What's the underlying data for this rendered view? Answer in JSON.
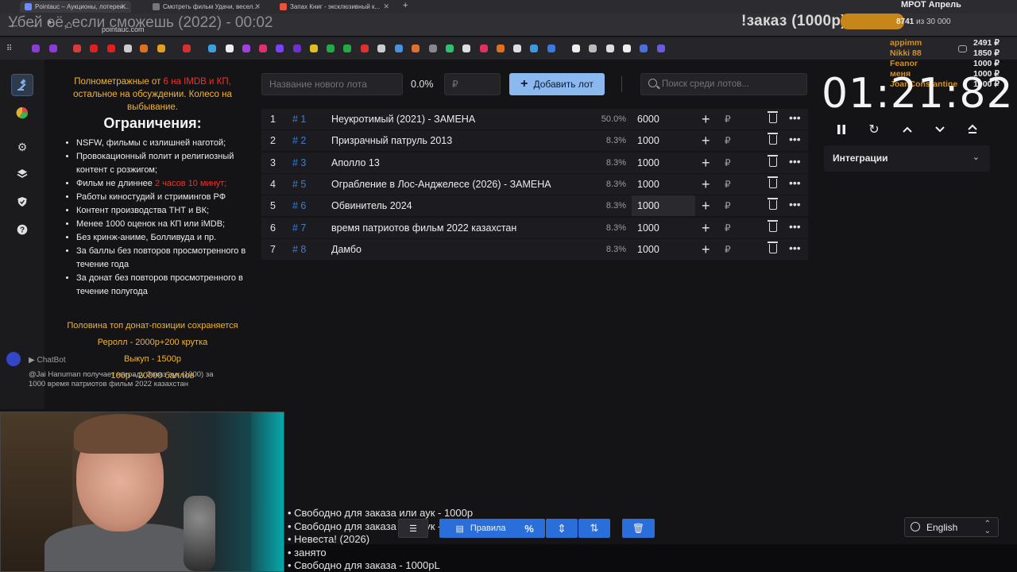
{
  "browser": {
    "tabs": [
      {
        "title": "Pointauc – Аукционы, лотереи...",
        "active": true
      },
      {
        "title": "Смотреть фильм Удачи, весел...",
        "active": false
      },
      {
        "title": "Запах Книг - эксклюзивный к...",
        "active": false
      }
    ],
    "url": "pointauc.com"
  },
  "overlay": {
    "stream_title": "Убей её, если сможешь (2022) - 00:02",
    "order_label": "!заказ (1000р)",
    "mrot_title": "МРОТ Апрель",
    "mrot_value": "8741",
    "mrot_of": "из 30 000",
    "donors": [
      {
        "name": "appimm",
        "amount": "2491 ₽"
      },
      {
        "name": "Nikki 88",
        "amount": "1850 ₽"
      },
      {
        "name": "Feanor",
        "amount": "1000 ₽"
      },
      {
        "name": "меня",
        "amount": "1000 ₽"
      },
      {
        "name": "JoanConstantine",
        "amount": "1000 ₽"
      }
    ]
  },
  "rules": {
    "head_pre": "Полнометражные от",
    "head_red": "6 на IMDB и КП,",
    "head_post": "остальное на обсуждении. Колесо на выбывание.",
    "title": "Ограничения:",
    "items": [
      "NSFW, фильмы с излишней наготой;",
      "Провокационный полит и религиозный контент с розжигом;",
      "Фильм не длиннее",
      "Работы киностудий и стримингов РФ",
      "Контент производства ТНТ и ВК;",
      "Менее 1000 оценок на КП или iMDB;",
      "Без кринж-аниме, Болливуда и пр.",
      "За баллы без повторов просмотренного в течение года",
      "За донат без повторов просмотренного в течение полугода"
    ],
    "length_red": "2 часов 10 минут;",
    "foot_1": "Половина топ донат-позиции сохраняется",
    "foot_2": "Реролл - 2000р+200 крутка",
    "foot_3": "Выкуп - 1500р",
    "foot_4": "100р - 20000 баллов"
  },
  "chatbot": {
    "name": "ChatBot",
    "message": "@Jai Hanuman получает награду Заказ аук (1000) за 1000 время патриотов фильм 2022 казахстан"
  },
  "new_lot": {
    "name_placeholder": "Название нового лота",
    "percent": "0.0%",
    "amount_placeholder": "₽",
    "add_label": "Добавить лот",
    "search_placeholder": "Поиск среди лотов..."
  },
  "lots": [
    {
      "index": "1",
      "fast": "# 1",
      "name": "Неукротимый (2021) - ЗАМЕНА",
      "percent": "50.0%",
      "amount": "6000"
    },
    {
      "index": "2",
      "fast": "# 2",
      "name": "Призрачный патруль 2013",
      "percent": "8.3%",
      "amount": "1000"
    },
    {
      "index": "3",
      "fast": "# 3",
      "name": "Аполло 13",
      "percent": "8.3%",
      "amount": "1000"
    },
    {
      "index": "4",
      "fast": "# 5",
      "name": "Ограбление в Лос-Анджелесе (2026) - ЗАМЕНА",
      "percent": "8.3%",
      "amount": "1000"
    },
    {
      "index": "5",
      "fast": "# 6",
      "name": "Обвинитель 2024",
      "percent": "8.3%",
      "amount": "1000"
    },
    {
      "index": "6",
      "fast": "# 7",
      "name": "время патриотов фильм 2022 казахстан",
      "percent": "8.3%",
      "amount": "1000"
    },
    {
      "index": "7",
      "fast": "# 8",
      "name": "Дамбо",
      "percent": "8.3%",
      "amount": "1000"
    }
  ],
  "lot_currency": "₽",
  "timer": {
    "value": "01:21:82"
  },
  "integrations": {
    "label": "Интеграции"
  },
  "ticker": [
    "• Свободно для заказа или аук - 1000р",
    "• Свободно для заказа или аук - 1000р",
    "• Невеста! (2026)",
    "• занято",
    "• Свободно для заказа - 1000рL"
  ],
  "toolbar": {
    "rules_label": "Правила",
    "percent_label": "%"
  },
  "language": {
    "label": "English"
  },
  "colors": {
    "accent": "#8ab8ef",
    "fast_id": "#3b7fd1",
    "warning": "#f2b430",
    "danger": "#e8342c",
    "order_bar": "#c7861a"
  }
}
